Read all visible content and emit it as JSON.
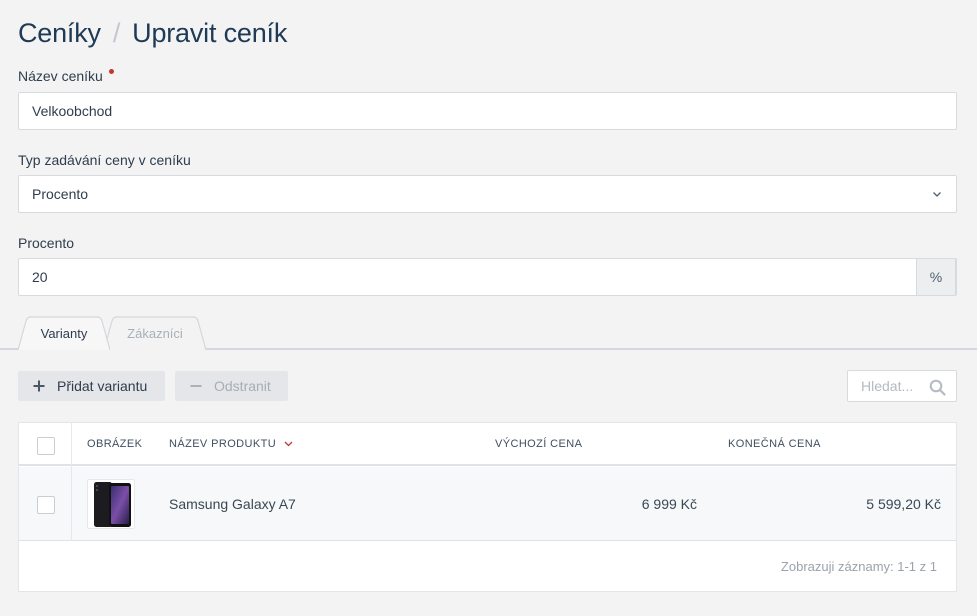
{
  "breadcrumb": {
    "parent": "Ceníky",
    "separator": "/",
    "current": "Upravit ceník"
  },
  "form": {
    "name": {
      "label": "Název ceníku",
      "required": true,
      "value": "Velkoobchod"
    },
    "price_type": {
      "label": "Typ zadávání ceny v ceníku",
      "value": "Procento"
    },
    "percent": {
      "label": "Procento",
      "value": "20",
      "addon": "%"
    }
  },
  "tabs": [
    {
      "label": "Varianty",
      "active": true
    },
    {
      "label": "Zákazníci",
      "active": false
    }
  ],
  "toolbar": {
    "add_label": "Přidat variantu",
    "remove_label": "Odstranit",
    "search_placeholder": "Hledat..."
  },
  "table": {
    "columns": {
      "image": "Obrázek",
      "product_name": "Název produktu",
      "default_price": "Výchozí cena",
      "final_price": "Konečná cena"
    },
    "rows": [
      {
        "product_name": "Samsung Galaxy A7",
        "default_price": "6 999 Kč",
        "final_price": "5 599,20 Kč"
      }
    ],
    "footer": "Zobrazuji záznamy: 1-1 z 1"
  },
  "colors": {
    "background": "#f3f3f4",
    "title": "#1e3a55",
    "required": "#c0392b",
    "sort_arrow": "#c0392b"
  }
}
